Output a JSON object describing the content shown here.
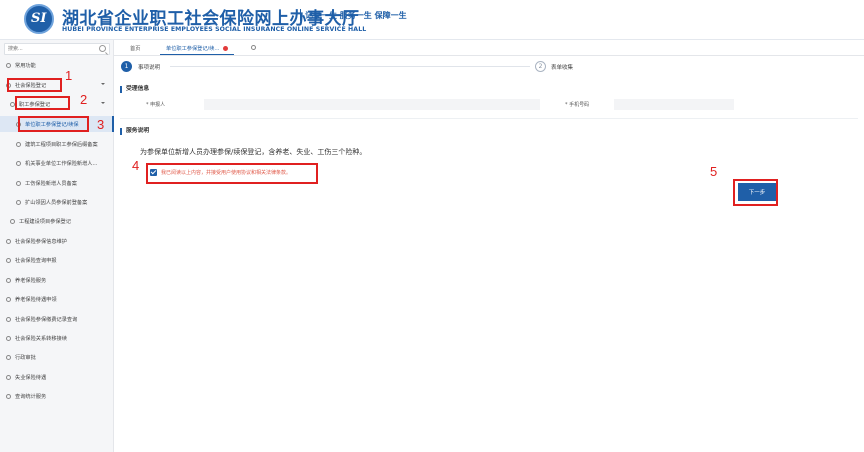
{
  "header": {
    "logo_text": "SI",
    "title_cn": "湖北省企业职工社会保险网上办事大厅",
    "title_en": "HUBEI PROVINCE ENTERPRISE EMPLOYEES SOCIAL INSURANCE ONLINE SERVICE HALL",
    "slogan": "记录一生  服务一生  保障一生"
  },
  "sidebar": {
    "search_placeholder": "搜索...",
    "items": [
      {
        "label": "常用功能"
      },
      {
        "label": "社会保险登记"
      },
      {
        "label": "职工参保登记"
      },
      {
        "label": "单位职工参保登记/续保"
      },
      {
        "label": "建筑工程项目职工参保后缀备案"
      },
      {
        "label": "机关事业单位工作保险新增人..."
      },
      {
        "label": "工伤保险新增人员备案"
      },
      {
        "label": "扩山领因人员参保前登备案"
      },
      {
        "label": "工程建设项目参保登记"
      },
      {
        "label": "社会保险参保信息维护"
      },
      {
        "label": "社会保险查询申报"
      },
      {
        "label": "养老保险服务"
      },
      {
        "label": "养老保险待遇申领"
      },
      {
        "label": "社会保险参保缴费记录查询"
      },
      {
        "label": "社会保险关系转移接续"
      },
      {
        "label": "行政审批"
      },
      {
        "label": "失业保险待遇"
      },
      {
        "label": "查询统计服务"
      }
    ]
  },
  "tabs": [
    {
      "label": "首页"
    },
    {
      "label": "单位职工参保登记/续..."
    }
  ],
  "steps": [
    {
      "num": "1",
      "label": "事项说明"
    },
    {
      "num": "2",
      "label": "表单收集"
    }
  ],
  "sections": {
    "applicant_title": "受理信息",
    "applicant_label": "* 申报人",
    "phone_label": "* 手机号码",
    "service_title": "服务说明"
  },
  "description": "为参保单位新增人员办理参保/续保登记，含养老、失业、工伤三个险种。",
  "agreement": "我已阅读以上内容，并接受用户使用协议和相关法律条款。",
  "next_button": "下一步",
  "annotations": [
    "1",
    "2",
    "3",
    "4",
    "5"
  ]
}
